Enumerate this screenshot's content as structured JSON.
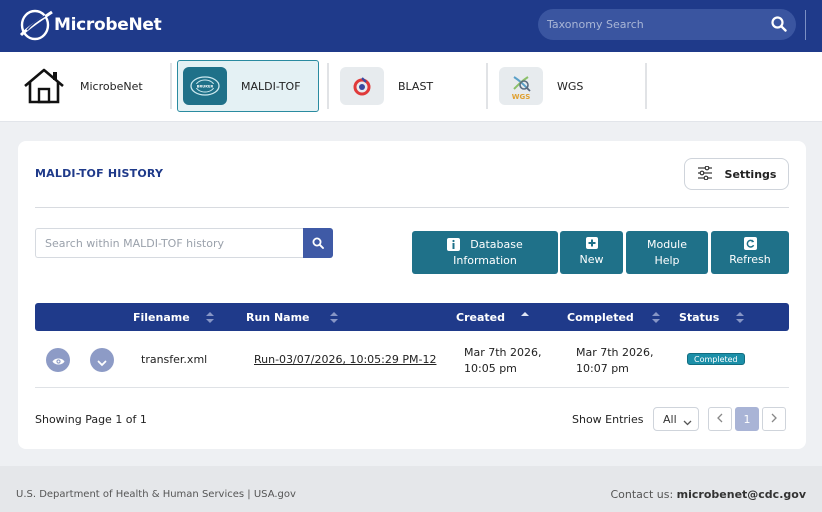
{
  "header": {
    "brand": "MicrobeNet",
    "search_placeholder": "Taxonomy Search"
  },
  "apps": [
    {
      "label": "MicrobeNet",
      "icon": "home-icon"
    },
    {
      "label": "MALDI-TOF",
      "icon": "bruker-logo-icon",
      "active": true
    },
    {
      "label": "BLAST",
      "icon": "blast-logo-icon"
    },
    {
      "label": "WGS",
      "icon": "wgs-logo-icon"
    }
  ],
  "history": {
    "title": "MALDI-TOF HISTORY",
    "settings_label": "Settings",
    "search_placeholder": "Search within MALDI-TOF history",
    "actions": {
      "database_info": [
        "Database",
        "Information"
      ],
      "new_label": "New",
      "module_help": [
        "Module",
        "Help"
      ],
      "refresh_label": "Refresh"
    },
    "columns": [
      "Filename",
      "Run Name",
      "Created",
      "Completed",
      "Status"
    ],
    "rows": [
      {
        "filename": "transfer.xml",
        "run_name": "Run-03/07/2026, 10:05:29 PM-12",
        "created": [
          "Mar 7th 2026,",
          "10:05 pm"
        ],
        "completed": [
          "Mar 7th 2026,",
          "10:07 pm"
        ],
        "status": "Completed"
      }
    ],
    "showing_text": "Showing Page 1 of 1",
    "show_entries_label": "Show Entries",
    "entries_value": "All",
    "current_page": "1"
  },
  "footer": {
    "left": "U.S. Department of Health & Human Services | USA.gov",
    "contact_label": "Contact us:",
    "contact_email": "microbenet@cdc.gov"
  },
  "colors": {
    "header": "#1f3a8a",
    "action_button": "#1f7189",
    "status_badge": "#1b8fa8"
  }
}
